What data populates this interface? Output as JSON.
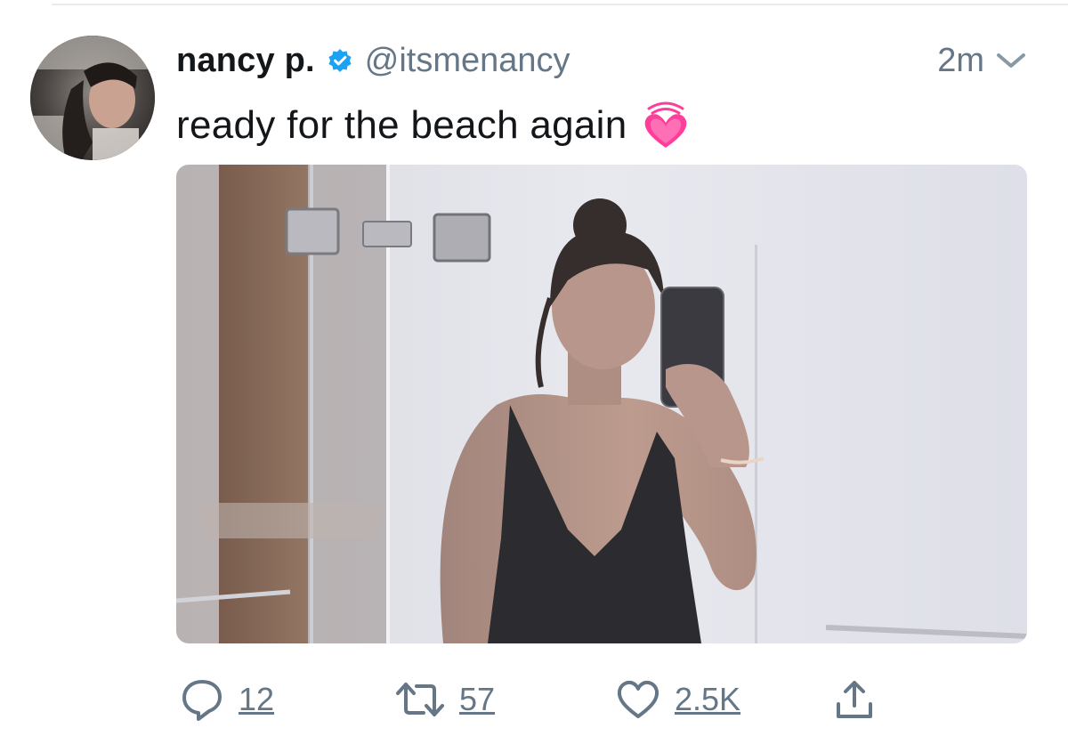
{
  "tweet": {
    "author": {
      "display_name": "nancy p.",
      "handle": "@itsmenancy",
      "verified": true,
      "avatar_icon": "profile-photo"
    },
    "timestamp": "2m",
    "text": "ready for the beach again",
    "emoji_icon": "growing-heart-icon",
    "media_icon": "mirror-selfie-photo",
    "actions": {
      "reply_count": "12",
      "retweet_count": "57",
      "like_count": "2.5K"
    }
  },
  "colors": {
    "verified_blue": "#1da1f2",
    "secondary_text": "#657786",
    "emoji_pink": "#ff3d9a"
  }
}
